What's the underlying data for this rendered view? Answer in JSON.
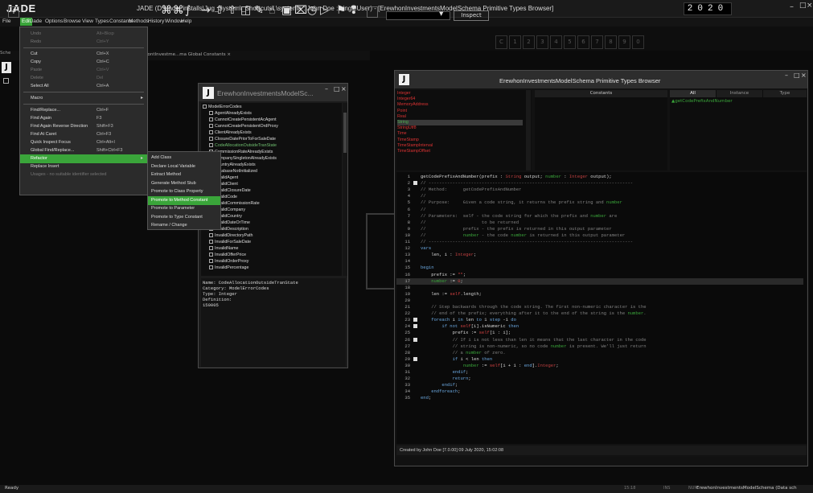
{
  "app": {
    "logo": "JADE",
    "title": "JADE (D:\\Jade_installs\\Jug_System\\_Shortcuts\\.\\systema : John Doe : singleUser) - [ErewhonInvestmentsModelSchema Primitive Types Browser]",
    "year": "2020"
  },
  "menubar": [
    "File",
    "Edit",
    "Jade",
    "Options",
    "Browse",
    "View",
    "Types",
    "Constants",
    "Methods",
    "History",
    "Window",
    "Help"
  ],
  "toolbar": {
    "inspect": "Inspect",
    "numbers": [
      "C",
      "1",
      "2",
      "3",
      "4",
      "5",
      "6",
      "7",
      "8",
      "9",
      "0"
    ]
  },
  "tabs": {
    "left": "Sche",
    "doc": "hontInvestme...ma Global Constants"
  },
  "edit_menu": [
    {
      "label": "Undo",
      "shortcut": "Alt+Bksp",
      "disabled": true
    },
    {
      "label": "Redo",
      "shortcut": "Ctrl+Y",
      "disabled": true
    },
    {
      "sep": true
    },
    {
      "label": "Cut",
      "shortcut": "Ctrl+X"
    },
    {
      "label": "Copy",
      "shortcut": "Ctrl+C"
    },
    {
      "label": "Paste",
      "shortcut": "Ctrl+V",
      "disabled": true
    },
    {
      "label": "Delete",
      "shortcut": "Del",
      "disabled": true
    },
    {
      "label": "Select All",
      "shortcut": "Ctrl+A"
    },
    {
      "sep": true
    },
    {
      "label": "Macro",
      "submenu": true
    },
    {
      "sep": true
    },
    {
      "label": "Find/Replace...",
      "shortcut": "Ctrl+F"
    },
    {
      "label": "Find Again",
      "shortcut": "F3"
    },
    {
      "label": "Find Again Reverse Direction",
      "shortcut": "Shift+F3"
    },
    {
      "label": "Find At Caret",
      "shortcut": "Ctrl+F3"
    },
    {
      "label": "Quick Inspect Focus",
      "shortcut": "Ctrl+Alt+I"
    },
    {
      "label": "Global Find/Replace...",
      "shortcut": "Shift+Ctrl+F3"
    },
    {
      "label": "Refactor",
      "submenu": true,
      "highlighted": true
    },
    {
      "label": "Replace Insert",
      "shortcut": ""
    },
    {
      "label": "Usages - no suitable identifier selected",
      "disabled": true
    }
  ],
  "refactor_menu": [
    {
      "label": "Add Class"
    },
    {
      "label": "Declare Local Variable"
    },
    {
      "label": "Extract Method"
    },
    {
      "label": "Generate Method Stub"
    },
    {
      "label": "Promote to Class Property"
    },
    {
      "label": "Promote to Method Constant",
      "highlighted": true
    },
    {
      "label": "Promote to Parameter"
    },
    {
      "label": "Promote to Type Constant"
    },
    {
      "label": "Rename / Change"
    }
  ],
  "tree_window": {
    "title": "ErewhonInvestmentsModelSc...",
    "root": "ModelErrorCodes",
    "items": [
      "AgentAlreadyExists",
      "CannotCreatePersistentAcAgent",
      "CannotCreatePersistentOrdProxy",
      "ClientAlreadyExists",
      "ClosureDatePriorToForSaleDate",
      "CodeAllocationOutsideTranState",
      "CommissionRateAlreadyExists",
      "CompanySingletonAlreadyExists",
      "CountryAlreadyExists",
      "DatabaseNotInitialized",
      "InvalidAgent",
      "InvalidClient",
      "InvalidClosureDate",
      "InvalidCode",
      "InvalidCommissionRate",
      "InvalidCompany",
      "InvalidCountry",
      "InvalidDateOrTime",
      "InvalidDescription",
      "InvalidDirectoryPath",
      "InvalidForSaleDate",
      "InvalidName",
      "InvalidOfferPrice",
      "InvalidOrderProxy",
      "InvalidPercentage"
    ],
    "selected_index": 5,
    "detail": [
      "Name: CodeAllocationOutsideTranState",
      "Category: ModelErrorCodes",
      "Type: Integer",
      "Definition:",
      "150005"
    ]
  },
  "browser": {
    "title": "ErewhonInvestmentsModelSchema Primitive Types Browser",
    "types": [
      "Integer",
      "Integer64",
      "MemoryAddress",
      "Point",
      "Real",
      "String",
      "StringUtf8",
      "Time",
      "TimeStamp",
      "TimeStampInterval",
      "TimeStampOffset"
    ],
    "selected_type": "String",
    "constants_header": "Constants",
    "methods_tabs": [
      "All",
      "Instance",
      "Type"
    ],
    "method_entry": "getCodePrefixAndNumber",
    "footer": "Created by John Doe [7.0.00] 09 July 2020, 15:02:08",
    "code": [
      {
        "n": "1",
        "html": "getCodePrefixAndNumber(prefix : <span class=\"ty\">String</span> output; <span class=\"gr\">number</span> : <span class=\"ty\">Integer</span> output);"
      },
      {
        "n": "2",
        "html": "<span class=\"cm\">// -----------------------------------------------------------------------------</span>",
        "mark": true
      },
      {
        "n": "3",
        "html": "<span class=\"cm\">// Method:      getCodePrefixAndNumber</span>"
      },
      {
        "n": "4",
        "html": "<span class=\"cm\">//</span>"
      },
      {
        "n": "5",
        "html": "<span class=\"cm\">// Purpose:     Given a code string, it returns the prefix string and </span><span class=\"gr\">number</span>"
      },
      {
        "n": "6",
        "html": "<span class=\"cm\">//</span>"
      },
      {
        "n": "7",
        "html": "<span class=\"cm\">// Parameters:  self - the code string for which the prefix and </span><span class=\"gr\">number</span><span class=\"cm\"> are</span>"
      },
      {
        "n": "8",
        "html": "<span class=\"cm\">//                     to be returned</span>"
      },
      {
        "n": "9",
        "html": "<span class=\"cm\">//              prefix - the prefix is returned in this output parameter</span>"
      },
      {
        "n": "10",
        "html": "<span class=\"cm\">//              </span><span class=\"gr\">number</span><span class=\"cm\"> - the code </span><span class=\"gr\">number</span><span class=\"cm\"> is returned in this output parameter</span>"
      },
      {
        "n": "11",
        "html": "<span class=\"cm\">// -----------------------------------------------------------------------------</span>"
      },
      {
        "n": "12",
        "html": "<span class=\"kw\">vars</span>"
      },
      {
        "n": "13",
        "html": "    len, i : <span class=\"ty\">Integer</span>;"
      },
      {
        "n": "14",
        "html": ""
      },
      {
        "n": "15",
        "html": "<span class=\"kw\">begin</span>"
      },
      {
        "n": "16",
        "html": "    prefix := <span class=\"rd\">\"\"</span>;"
      },
      {
        "n": "17",
        "html": "    <span class=\"gr\">number</span> := <span class=\"rd\">0</span>;",
        "hl": true
      },
      {
        "n": "18",
        "html": ""
      },
      {
        "n": "19",
        "html": "    len := <span class=\"rd\">self</span>.length;"
      },
      {
        "n": "20",
        "html": ""
      },
      {
        "n": "21",
        "html": "    <span class=\"cm\">// Step backwards through the code string. The first non-numeric character is the</span>"
      },
      {
        "n": "22",
        "html": "    <span class=\"cm\">// end of the prefix; everything after it to the end of the string is the </span><span class=\"gr\">number</span><span class=\"cm\">.</span>"
      },
      {
        "n": "23",
        "html": "    <span class=\"kw\">foreach</span> i <span class=\"kw\">in</span> len <span class=\"kw\">to</span> 1 <span class=\"kw\">step</span> -1 <span class=\"kw\">do</span>",
        "mark": true
      },
      {
        "n": "24",
        "html": "        <span class=\"kw\">if not</span> <span class=\"rd\">self</span>[i].isNumeric <span class=\"kw\">then</span>",
        "mark": true
      },
      {
        "n": "25",
        "html": "            prefix := <span class=\"rd\">self</span>[1 : i];"
      },
      {
        "n": "26",
        "html": "            <span class=\"cm\">// If i is not less than len it means that the last character in the code</span>",
        "mark": true
      },
      {
        "n": "27",
        "html": "            <span class=\"cm\">// string is non-numeric, so no code </span><span class=\"gr\">number</span><span class=\"cm\"> is present. We'll just return</span>"
      },
      {
        "n": "28",
        "html": "            <span class=\"cm\">// a </span><span class=\"gr\">number</span><span class=\"cm\"> of zero.</span>"
      },
      {
        "n": "29",
        "html": "            <span class=\"kw\">if</span> i &lt; len <span class=\"kw\">then</span>",
        "mark": true
      },
      {
        "n": "30",
        "html": "                <span class=\"gr\">number</span> := <span class=\"rd\">self</span>[i + 1 : <span class=\"kw\">end</span>].<span class=\"ty\">Integer</span>;"
      },
      {
        "n": "31",
        "html": "            <span class=\"kw\">endif</span>;"
      },
      {
        "n": "32",
        "html": "            <span class=\"kw\">return</span>;"
      },
      {
        "n": "33",
        "html": "        <span class=\"kw\">endif</span>;"
      },
      {
        "n": "34",
        "html": "    <span class=\"kw\">endforeach</span>;"
      },
      {
        "n": "35",
        "html": "<span class=\"kw\">end</span>;"
      }
    ]
  },
  "statusbar": {
    "ready": "Ready",
    "time": "15:18",
    "ins": "INS",
    "num": "NUM",
    "schema": "ErewhonInvestmentsModelSchema (Data sch"
  }
}
